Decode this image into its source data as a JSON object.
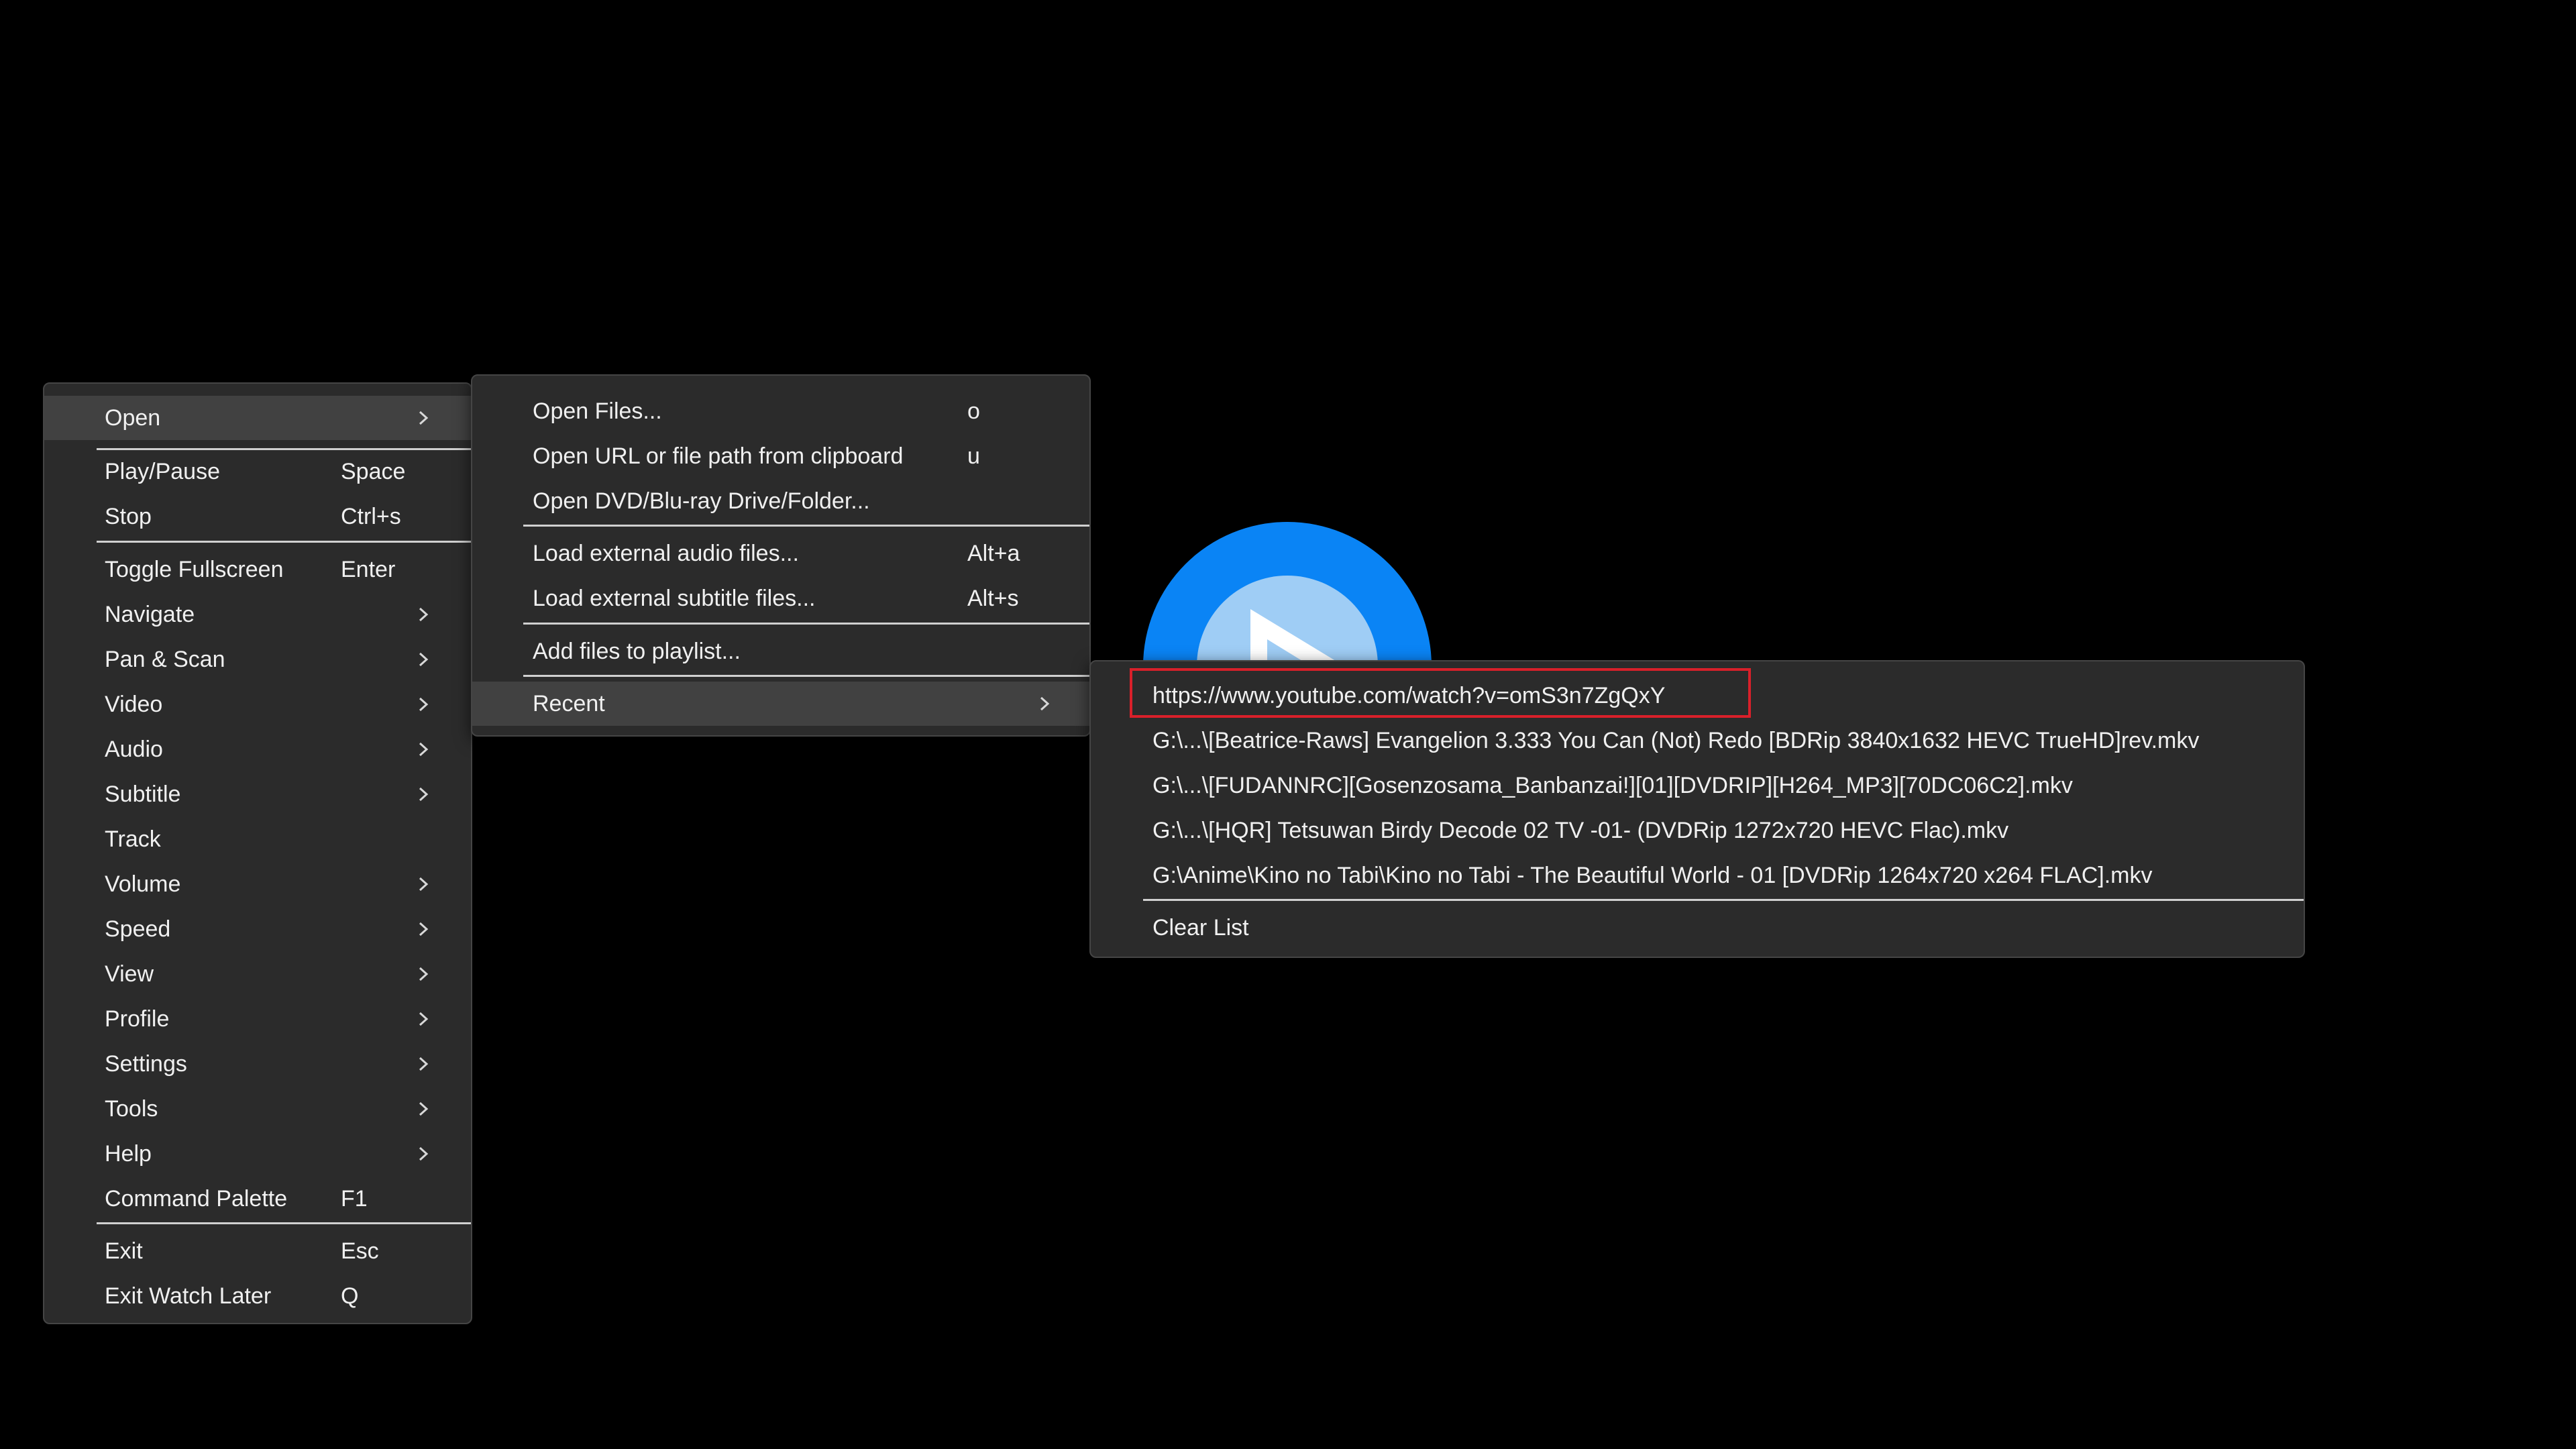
{
  "main_menu": {
    "items": [
      {
        "label": "Open",
        "submenu": true
      },
      {
        "label": "Play/Pause",
        "shortcut": "Space"
      },
      {
        "label": "Stop",
        "shortcut": "Ctrl+s"
      },
      {
        "label": "Toggle Fullscreen",
        "shortcut": "Enter"
      },
      {
        "label": "Navigate",
        "submenu": true
      },
      {
        "label": "Pan & Scan",
        "submenu": true
      },
      {
        "label": "Video",
        "submenu": true
      },
      {
        "label": "Audio",
        "submenu": true
      },
      {
        "label": "Subtitle",
        "submenu": true
      },
      {
        "label": "Track"
      },
      {
        "label": "Volume",
        "submenu": true
      },
      {
        "label": "Speed",
        "submenu": true
      },
      {
        "label": "View",
        "submenu": true
      },
      {
        "label": "Profile",
        "submenu": true
      },
      {
        "label": "Settings",
        "submenu": true
      },
      {
        "label": "Tools",
        "submenu": true
      },
      {
        "label": "Help",
        "submenu": true
      },
      {
        "label": "Command Palette",
        "shortcut": "F1"
      },
      {
        "label": "Exit",
        "shortcut": "Esc"
      },
      {
        "label": "Exit Watch Later",
        "shortcut": "Q"
      }
    ]
  },
  "open_menu": {
    "items": [
      {
        "label": "Open Files...",
        "shortcut": "o"
      },
      {
        "label": "Open URL or file path from clipboard",
        "shortcut": "u"
      },
      {
        "label": "Open DVD/Blu-ray Drive/Folder..."
      },
      {
        "label": "Load external audio files...",
        "shortcut": "Alt+a"
      },
      {
        "label": "Load external subtitle files...",
        "shortcut": "Alt+s"
      },
      {
        "label": "Add files to playlist..."
      },
      {
        "label": "Recent",
        "submenu": true
      }
    ]
  },
  "recent_menu": {
    "items": [
      {
        "label": "https://www.youtube.com/watch?v=omS3n7ZgQxY"
      },
      {
        "label": "G:\\...\\[Beatrice-Raws] Evangelion 3.333 You Can (Not) Redo [BDRip 3840x1632 HEVC TrueHD]rev.mkv"
      },
      {
        "label": "G:\\...\\[FUDANNRC][Gosenzosama_Banbanzai!][01][DVDRIP][H264_MP3][70DC06C2].mkv"
      },
      {
        "label": "G:\\...\\[HQR] Tetsuwan Birdy Decode 02 TV -01- (DVDRip 1272x720 HEVC Flac).mkv"
      },
      {
        "label": "G:\\Anime\\Kino no Tabi\\Kino no Tabi - The Beautiful World - 01 [DVDRip 1264x720 x264 FLAC].mkv"
      },
      {
        "label": "Clear List"
      }
    ]
  },
  "icons": {
    "submenu_arrow": "chevron-right-icon",
    "app_logo": "play-logo-icon"
  },
  "colors": {
    "menu_bg": "#2b2b2b",
    "menu_highlight": "#414141",
    "separator": "#d0d0d0",
    "highlight_box": "#d9202a",
    "logo_blue": "#0a84f5"
  }
}
